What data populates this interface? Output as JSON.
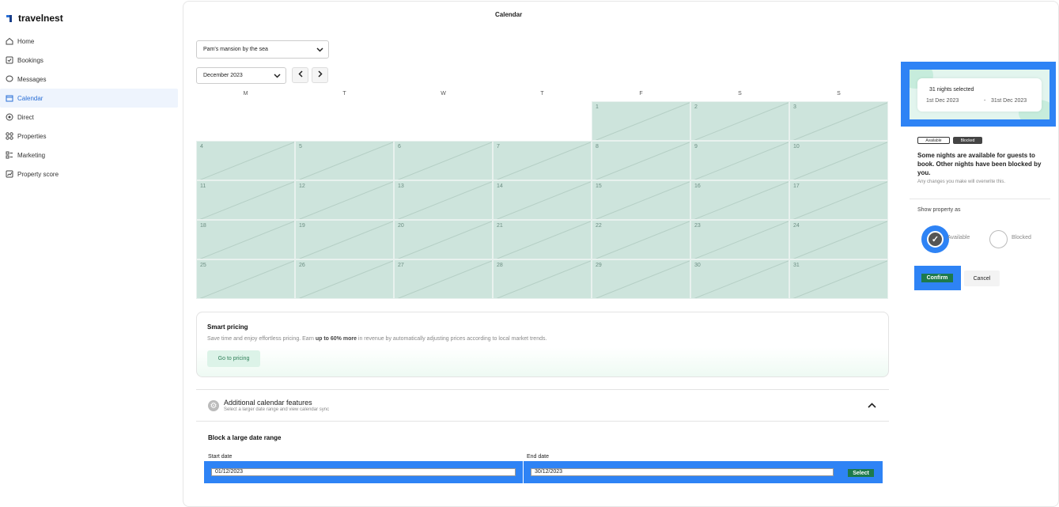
{
  "brand": {
    "name": "travelnest"
  },
  "sidebar": {
    "items": [
      {
        "label": "Home",
        "icon": "home-icon",
        "active": false
      },
      {
        "label": "Bookings",
        "icon": "bookings-icon",
        "active": false
      },
      {
        "label": "Messages",
        "icon": "messages-icon",
        "active": false
      },
      {
        "label": "Calendar",
        "icon": "calendar-icon",
        "active": true
      },
      {
        "label": "Direct",
        "icon": "direct-icon",
        "active": false
      },
      {
        "label": "Properties",
        "icon": "properties-icon",
        "active": false
      },
      {
        "label": "Marketing",
        "icon": "marketing-icon",
        "active": false
      },
      {
        "label": "Property score",
        "icon": "property-score-icon",
        "active": false
      }
    ]
  },
  "main": {
    "title": "Calendar",
    "property_select": "Pam's mansion by the sea",
    "month_select": "December 2023",
    "weekdays": [
      "M",
      "T",
      "W",
      "T",
      "F",
      "S",
      "S"
    ],
    "calendar": {
      "first_weekday_index": 4,
      "days": [
        "1",
        "2",
        "3",
        "4",
        "5",
        "6",
        "7",
        "8",
        "9",
        "10",
        "11",
        "12",
        "13",
        "14",
        "15",
        "16",
        "17",
        "18",
        "19",
        "20",
        "21",
        "22",
        "23",
        "24",
        "25",
        "26",
        "27",
        "28",
        "29",
        "30",
        "31"
      ]
    }
  },
  "smart_pricing": {
    "title": "Smart pricing",
    "desc_before": "Save time and enjoy effortless pricing. Earn ",
    "desc_bold": "up to 60% more",
    "desc_after": " in revenue by automatically adjusting prices according to local market trends.",
    "button": "Go to pricing"
  },
  "additional": {
    "title": "Additional calendar features",
    "subtitle": "Select a larger date range and view calendar sync"
  },
  "block_range": {
    "title": "Block a large date range",
    "start_label": "Start date",
    "start_value": "01/12/2023",
    "end_label": "End date",
    "end_value": "30/12/2023",
    "select_button": "Select"
  },
  "right_panel": {
    "nights": "31 nights selected",
    "from": "1st Dec 2023",
    "separator": "-",
    "to": "31st Dec 2023",
    "legend_available": "Available",
    "legend_blocked": "Blocked",
    "description": "Some nights are available for guests to book. Other nights have been blocked by you.",
    "note": "Any changes you make will overwrite this.",
    "show_as": "Show property as",
    "option_available": "Available",
    "option_blocked": "Blocked",
    "confirm": "Confirm",
    "cancel": "Cancel"
  },
  "colors": {
    "accent": "#2a6fd6",
    "highlight": "#2e83f5",
    "green": "#1d7a4c",
    "cell": "#cde4dc"
  }
}
